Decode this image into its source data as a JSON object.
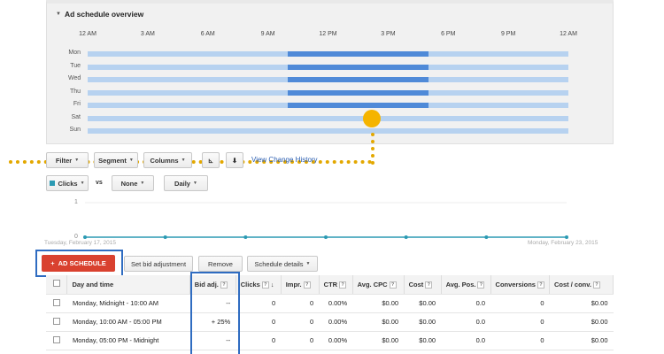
{
  "overview": {
    "title": "Ad schedule overview",
    "hours": [
      "12 AM",
      "3 AM",
      "6 AM",
      "9 AM",
      "12 PM",
      "3 PM",
      "6 PM",
      "9 PM",
      "12 AM"
    ],
    "days": [
      {
        "label": "Mon",
        "active_from_hour": 10,
        "active_to_hour": 17
      },
      {
        "label": "Tue",
        "active_from_hour": 10,
        "active_to_hour": 17
      },
      {
        "label": "Wed",
        "active_from_hour": 10,
        "active_to_hour": 17
      },
      {
        "label": "Thu",
        "active_from_hour": 10,
        "active_to_hour": 17
      },
      {
        "label": "Fri",
        "active_from_hour": 10,
        "active_to_hour": 17
      },
      {
        "label": "Sat",
        "active_from_hour": null,
        "active_to_hour": null
      },
      {
        "label": "Sun",
        "active_from_hour": null,
        "active_to_hour": null
      }
    ],
    "colors": {
      "bar_base": "#b7d2f0",
      "bar_active": "#4f8ad8"
    }
  },
  "toolbar": {
    "filter_label": "Filter",
    "segment_label": "Segment",
    "columns_label": "Columns",
    "view_change_history": "View Change History"
  },
  "chart_controls": {
    "metric_label": "Clicks",
    "vs_label": "vs",
    "compare_label": "None",
    "period_label": "Daily"
  },
  "chart": {
    "y_tick_top": "1",
    "y_tick_bottom": "0",
    "start_date": "Tuesday, February 17, 2015",
    "end_date": "Monday, February 23, 2015",
    "line_color": "#2b9ab3"
  },
  "actions": {
    "ad_schedule_label": "AD SCHEDULE",
    "set_bid_label": "Set bid adjustment",
    "remove_label": "Remove",
    "schedule_details_label": "Schedule details"
  },
  "table": {
    "columns": [
      "Day and time",
      "Bid adj.",
      "Clicks",
      "Impr.",
      "CTR",
      "Avg. CPC",
      "Cost",
      "Avg. Pos.",
      "Conversions",
      "Cost / conv."
    ],
    "rows": [
      {
        "day_time": "Monday, Midnight - 10:00 AM",
        "bid_adj": "--",
        "clicks": "0",
        "impr": "0",
        "ctr": "0.00%",
        "avg_cpc": "$0.00",
        "cost": "$0.00",
        "avg_pos": "0.0",
        "conversions": "0",
        "cost_conv": "$0.00"
      },
      {
        "day_time": "Monday, 10:00 AM - 05:00 PM",
        "bid_adj": "+ 25%",
        "clicks": "0",
        "impr": "0",
        "ctr": "0.00%",
        "avg_cpc": "$0.00",
        "cost": "$0.00",
        "avg_pos": "0.0",
        "conversions": "0",
        "cost_conv": "$0.00"
      },
      {
        "day_time": "Monday, 05:00 PM - Midnight",
        "bid_adj": "--",
        "clicks": "0",
        "impr": "0",
        "ctr": "0.00%",
        "avg_cpc": "$0.00",
        "cost": "$0.00",
        "avg_pos": "0.0",
        "conversions": "0",
        "cost_conv": "$0.00"
      }
    ]
  },
  "colors": {
    "accent_red": "#d9412f",
    "highlight_blue": "#2f6cc1",
    "annotation_orange": "#f5b400"
  }
}
